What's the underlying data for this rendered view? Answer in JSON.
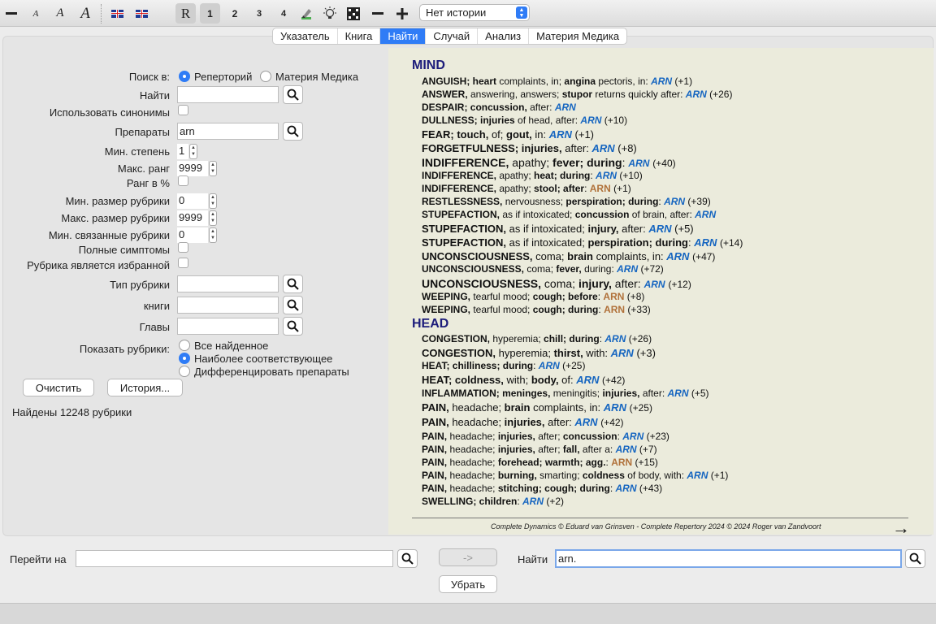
{
  "toolbar": {
    "font_small": "A",
    "font_medium": "A",
    "font_large": "A",
    "rep_mode": "R",
    "levels": [
      "1",
      "2",
      "3",
      "4"
    ],
    "history_value": "Нет истории"
  },
  "tabs": [
    "Указатель",
    "Книга",
    "Найти",
    "Случай",
    "Анализ",
    "Материя Медика"
  ],
  "form": {
    "search_in_label": "Поиск в:",
    "search_in_options": [
      "Реперторий",
      "Материя Медика"
    ],
    "find_label": "Найти",
    "find_value": "",
    "synonyms_label": "Использовать синонимы",
    "remedies_label": "Препараты",
    "remedies_value": "arn",
    "min_degree_label": "Мин. степень",
    "min_degree_value": "1",
    "max_rank_label": "Макс. ранг",
    "max_rank_value": "9999",
    "rank_percent_label": "Ранг в %",
    "min_size_label": "Мин. размер рубрики",
    "min_size_value": "0",
    "max_size_label": "Макс. размер рубрики",
    "max_size_value": "9999",
    "min_related_label": "Мин. связанные рубрики",
    "min_related_value": "0",
    "full_symptoms_label": "Полные симптомы",
    "favorite_label": "Рубрика является избранной",
    "rubric_type_label": "Тип рубрики",
    "books_label": "книги",
    "chapters_label": "Главы",
    "show_label": "Показать рубрики:",
    "show_options": [
      "Все найденное",
      "Наиболее соответствующее",
      "Дифференцировать препараты"
    ],
    "clear_button": "Очистить",
    "history_button": "История...",
    "found_text": "Найдены 12248 рубрики"
  },
  "results": {
    "mind_title": "MIND",
    "head_title": "HEAD",
    "copyright": "Complete Dynamics © Eduard van Grinsven   -   Complete Repertory 2024 © 2024 Roger van Zandvoort"
  },
  "bottom": {
    "goto_label": "Перейти на",
    "goto_value": "",
    "arrow_button": "->",
    "find_label": "Найти",
    "find_value": "arn.",
    "remove_button": "Убрать"
  }
}
